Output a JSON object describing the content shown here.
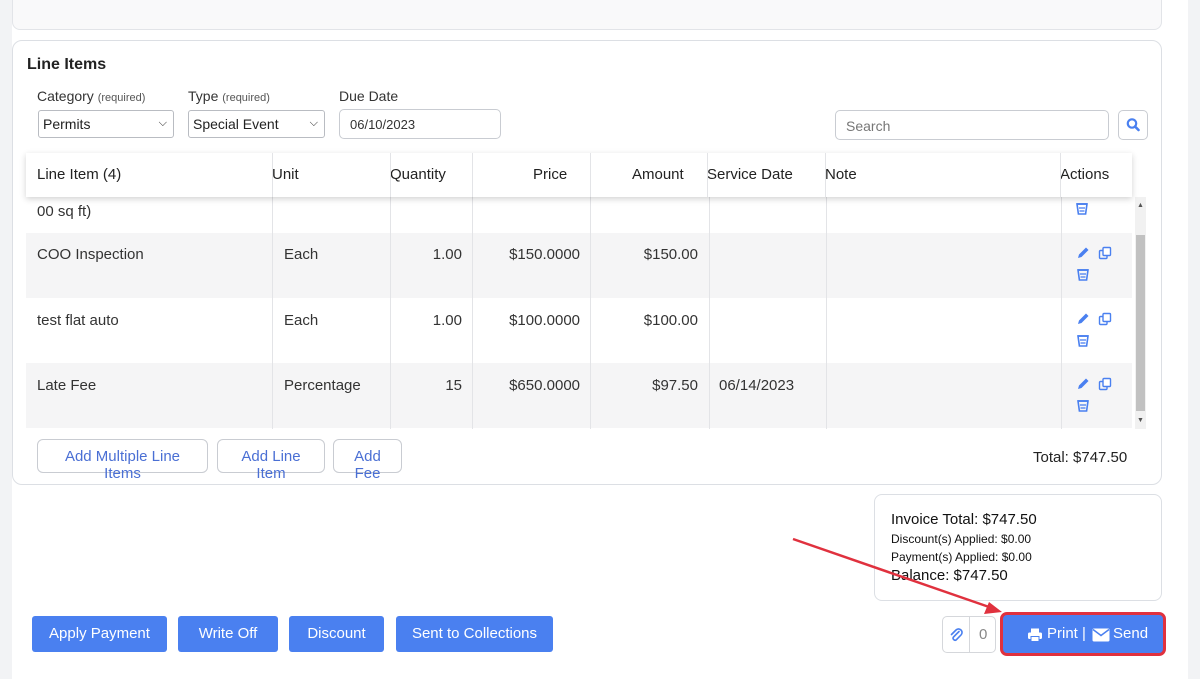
{
  "section_title": "Line Items",
  "filters": {
    "category_label": "Category",
    "category_req": "(required)",
    "category_value": "Permits",
    "type_label": "Type",
    "type_req": "(required)",
    "type_value": "Special Event",
    "due_label": "Due Date",
    "due_value": "06/10/2023",
    "search_placeholder": "Search"
  },
  "table": {
    "headers": [
      "Line Item (4)",
      "Unit",
      "Quantity",
      "Price",
      "Amount",
      "Service Date",
      "Note",
      "Actions"
    ],
    "partial_row": "00 sq ft)",
    "rows": [
      {
        "item": "COO Inspection",
        "unit": "Each",
        "qty": "1.00",
        "price": "$150.0000",
        "amount": "$150.00",
        "date": ""
      },
      {
        "item": "test flat auto",
        "unit": "Each",
        "qty": "1.00",
        "price": "$100.0000",
        "amount": "$100.00",
        "date": ""
      },
      {
        "item": "Late Fee",
        "unit": "Percentage",
        "qty": "15",
        "price": "$650.0000",
        "amount": "$97.50",
        "date": "06/14/2023"
      }
    ]
  },
  "line_buttons": {
    "add_multiple": "Add Multiple Line Items",
    "add_line": "Add Line Item",
    "add_fee": "Add Fee"
  },
  "line_total": "Total: $747.50",
  "summary": {
    "invoice_total": "Invoice Total: $747.50",
    "discounts": "Discount(s) Applied: $0.00",
    "payments": "Payment(s) Applied: $0.00",
    "balance": "Balance: $747.50"
  },
  "actions": {
    "apply_payment": "Apply Payment",
    "write_off": "Write Off",
    "discount": "Discount",
    "collections": "Sent to Collections",
    "attachments_count": "0",
    "print": "Print |",
    "send": "Send"
  },
  "colors": {
    "primary": "#4a80f0",
    "link": "#4a6fd4",
    "highlight": "#e0313e"
  }
}
